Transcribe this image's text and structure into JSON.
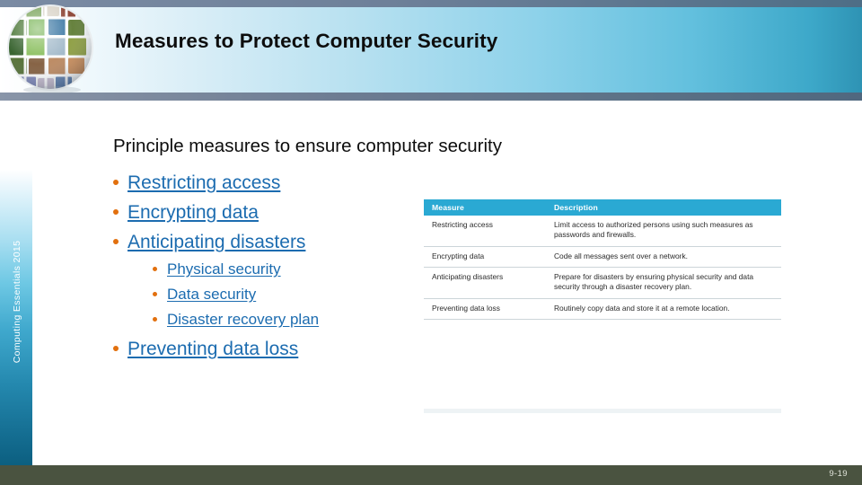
{
  "slide": {
    "title": "Measures to Protect Computer Security",
    "sidebar_label": "Computing Essentials 2015",
    "page_number": "9-19",
    "colors": {
      "header_gradient_start": "#ffffff",
      "header_gradient_end": "#2e93b4",
      "header_strip": "#6d7c92",
      "sidebar_bottom": "#0c5f80",
      "footer": "#4a5340",
      "bullet": "#e2700e",
      "link": "#1c6cb0",
      "table_header": "#2aa9d3"
    }
  },
  "content": {
    "intro": "Principle measures to ensure computer security",
    "bullets": [
      {
        "label": "Restricting access"
      },
      {
        "label": "Encrypting data"
      },
      {
        "label": "Anticipating disasters",
        "children": [
          {
            "label": "Physical security"
          },
          {
            "label": "Data security"
          },
          {
            "label": "Disaster recovery plan"
          }
        ]
      },
      {
        "label": "Preventing data loss"
      }
    ]
  },
  "table": {
    "columns": [
      "Measure",
      "Description"
    ],
    "rows": [
      {
        "measure": "Restricting access",
        "description": "Limit access to authorized persons using such measures as passwords and firewalls."
      },
      {
        "measure": "Encrypting data",
        "description": "Code all messages sent over a network."
      },
      {
        "measure": "Anticipating disasters",
        "description": "Prepare for disasters by ensuring physical security and data security through a disaster recovery plan."
      },
      {
        "measure": "Preventing data loss",
        "description": "Routinely copy data and store it at a remote location."
      }
    ]
  },
  "icons": {
    "globe": "globe-photo-mosaic-icon"
  }
}
